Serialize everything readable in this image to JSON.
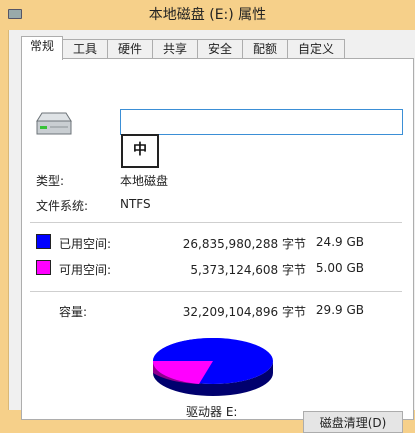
{
  "window": {
    "title": "本地磁盘 (E:) 属性"
  },
  "tabs": [
    {
      "label": "常规"
    },
    {
      "label": "工具"
    },
    {
      "label": "硬件"
    },
    {
      "label": "共享"
    },
    {
      "label": "安全"
    },
    {
      "label": "配额"
    },
    {
      "label": "自定义"
    }
  ],
  "general": {
    "drive_name_value": "",
    "ime_indicator": "中",
    "type_label": "类型:",
    "type_value": "本地磁盘",
    "fs_label": "文件系统:",
    "fs_value": "NTFS",
    "used": {
      "label": "已用空间:",
      "bytes": "26,835,980,288 字节",
      "size": "24.9 GB",
      "color": "#0000ff"
    },
    "free": {
      "label": "可用空间:",
      "bytes": "5,373,124,608 字节",
      "size": "5.00 GB",
      "color": "#ff00ff"
    },
    "capacity": {
      "label": "容量:",
      "bytes": "32,209,104,896 字节",
      "size": "29.9 GB"
    },
    "drive_label": "驱动器 E:",
    "cleanup_button": "磁盘清理(D)"
  }
}
